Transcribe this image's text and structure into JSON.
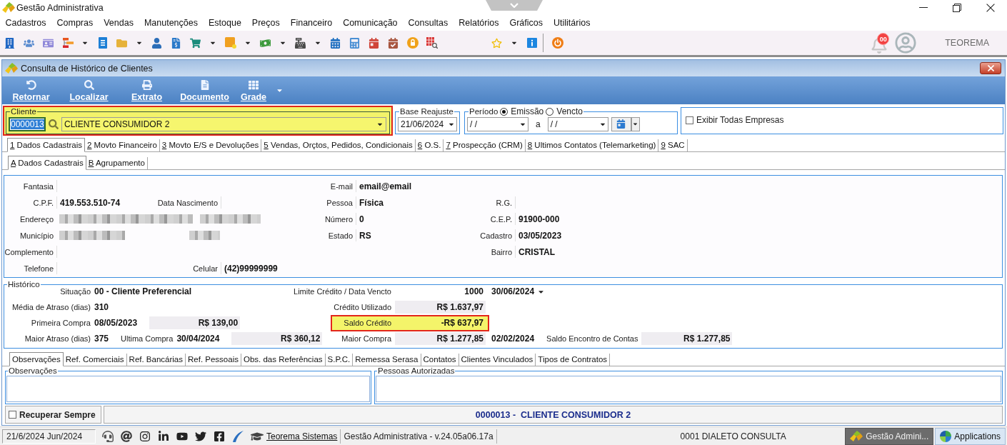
{
  "window": {
    "title": "Gestão Administrativa"
  },
  "menu": [
    "Cadastros",
    "Compras",
    "Vendas",
    "Manutenções",
    "Estoque",
    "Preços",
    "Financeiro",
    "Comunicação",
    "Consultas",
    "Relatórios",
    "Gráficos",
    "Utilitários"
  ],
  "toolbar": {
    "groups": [
      [
        {
          "menu": false
        },
        {
          "menu": false
        },
        {
          "menu": false
        },
        {
          "menu": true
        },
        {
          "menu": false
        },
        {
          "menu": true
        },
        {
          "menu": false
        },
        {
          "menu": false
        },
        {
          "menu": true
        },
        {
          "menu": true
        },
        {
          "menu": true
        },
        {
          "menu": true
        },
        {
          "menu": false
        },
        {
          "menu": false
        },
        {
          "menu": false
        },
        {
          "menu": false
        },
        {
          "menu": false
        },
        {
          "menu": false
        }
      ],
      [
        {
          "menu": true
        },
        {
          "menu": false
        }
      ],
      [
        {
          "menu": false
        }
      ]
    ],
    "notification_badge": "00",
    "user": "TEOREMA"
  },
  "form": {
    "title": "Consulta de Histórico de Clientes",
    "actions": [
      {
        "label": "Retornar",
        "menu": false
      },
      {
        "label": "Localizar",
        "menu": false
      },
      {
        "label": "Extrato",
        "menu": false
      },
      {
        "label": "Documento",
        "menu": false
      },
      {
        "label": "Grade",
        "menu": true
      }
    ],
    "client": {
      "legend": "Cliente",
      "code": "0000013",
      "code_selected": true,
      "name": "CLIENTE CONSUMIDOR 2",
      "highlighted": true
    },
    "base_reajuste": {
      "legend": "Base Reajuste",
      "value": "21/06/2024"
    },
    "periodo": {
      "legend": "Período",
      "options": [
        {
          "label": "Emissão",
          "selected": true
        },
        {
          "label": "Vencto",
          "selected": false
        }
      ],
      "from": "/ /",
      "separator": "a",
      "to": "/ /"
    },
    "all_companies": {
      "label": "Exibir Todas Empresas",
      "checked": false
    },
    "main_tabs": [
      {
        "key": "1",
        "label": "Dados Cadastrais",
        "selected": true
      },
      {
        "key": "2",
        "label": "Movto Financeiro",
        "selected": false
      },
      {
        "key": "3",
        "label": "Movto E/S e Devoluções",
        "selected": false
      },
      {
        "key": "5",
        "label": "Vendas, Orçtos, Pedidos, Condicionais",
        "selected": false
      },
      {
        "key": "6",
        "label": "O.S.",
        "selected": false
      },
      {
        "key": "7",
        "label": "Prospecção (CRM)",
        "selected": false
      },
      {
        "key": "8",
        "label": "Ultimos Contatos (Telemarketing)",
        "selected": false
      },
      {
        "key": "9",
        "label": "SAC",
        "selected": false
      }
    ],
    "sub_tabs": [
      {
        "key": "A",
        "label": "Dados Cadastrais",
        "selected": true
      },
      {
        "key": "B",
        "label": "Agrupamento",
        "selected": false
      }
    ],
    "details": [
      {
        "col_1": {
          "label": "Fantasia"
        },
        "col_3": {
          "label": "E-mail",
          "value": "email@email"
        }
      },
      {
        "col_1": {
          "label": "C.P.F.",
          "value": "419.553.510-74"
        },
        "col_2": {
          "label": "Data Nascimento"
        },
        "col_3": {
          "label": "Pessoa",
          "value": "Física"
        },
        "col_4": {
          "label": "R.G."
        }
      },
      {
        "col_1": {
          "label": "Endereço",
          "redacted": true
        },
        "col_3": {
          "label": "Número",
          "value": "0"
        },
        "col_4": {
          "label": "C.E.P.",
          "value": "91900-000"
        }
      },
      {
        "col_1": {
          "label": "Município",
          "redacted": true
        },
        "col_3": {
          "label": "Estado",
          "value": "RS"
        },
        "col_4": {
          "label": "Cadastro",
          "value": "03/05/2023"
        }
      },
      {
        "col_1": {
          "label": "Complemento"
        },
        "col_4": {
          "label": "Bairro",
          "value": "CRISTAL"
        }
      },
      {
        "col_1": {
          "label": "Telefone"
        },
        "col_2": {
          "label": "Celular",
          "value": "(42)99999999"
        }
      }
    ],
    "history": {
      "legend": "Histórico",
      "rows": [
        {
          "left": [
            {
              "kind": "label",
              "text": "Situação"
            },
            {
              "kind": "value",
              "text": "00 - Cliente Preferencial"
            }
          ],
          "right": {
            "highlighted": false,
            "items": [
              {
                "kind": "label",
                "text": "Limite Crédito / Data Vencto"
              },
              {
                "kind": "figure",
                "text": "1000"
              },
              {
                "kind": "date_select",
                "text": "30/06/2024"
              }
            ]
          }
        },
        {
          "left": [
            {
              "kind": "label",
              "text": "Média de Atraso (dias)"
            },
            {
              "kind": "value",
              "text": "310"
            }
          ],
          "right": {
            "highlighted": false,
            "items": [
              {
                "kind": "label",
                "text": "Crédito Utilizado"
              },
              {
                "kind": "amount",
                "text": "R$ 1.637,97"
              }
            ]
          }
        },
        {
          "left": [
            {
              "kind": "label",
              "text": "Primeira Compra"
            },
            {
              "kind": "value",
              "text": "08/05/2023"
            },
            {
              "kind": "amount",
              "text": "R$ 139,00"
            }
          ],
          "right": {
            "highlighted": true,
            "items": [
              {
                "kind": "label",
                "text": "Saldo Crédito"
              },
              {
                "kind": "amount",
                "text": "-R$ 637,97"
              }
            ]
          }
        },
        {
          "left": [
            {
              "kind": "label",
              "text": "Maior Atraso (dias)"
            },
            {
              "kind": "value",
              "text": "375"
            },
            {
              "kind": "label",
              "text": "Ultima Compra"
            },
            {
              "kind": "value",
              "text": "30/04/2024"
            },
            {
              "kind": "amount",
              "text": "R$ 360,12"
            }
          ],
          "right": {
            "highlighted": false,
            "items": [
              {
                "kind": "label",
                "text": "Maior Compra"
              },
              {
                "kind": "amount",
                "text": "R$ 1.277,85"
              },
              {
                "kind": "value",
                "text": "02/02/2024"
              },
              {
                "kind": "label",
                "text": "Saldo Encontro de Contas"
              },
              {
                "kind": "amount",
                "text": "R$ 1.277,85"
              }
            ]
          }
        }
      ]
    },
    "detail_tabs": [
      {
        "label": "Observações",
        "selected": true
      },
      {
        "label": "Ref. Comerciais",
        "selected": false
      },
      {
        "label": "Ref. Bancárias",
        "selected": false
      },
      {
        "label": "Ref. Pessoais",
        "selected": false
      },
      {
        "label": "Obs. das Referências",
        "selected": false
      },
      {
        "label": "S.P.C.",
        "selected": false
      },
      {
        "label": "Remessa Serasa",
        "selected": false
      },
      {
        "label": "Contatos",
        "selected": false
      },
      {
        "label": "Clientes Vinculados",
        "selected": false
      },
      {
        "label": "Tipos de Contratos",
        "selected": false
      }
    ],
    "notes": [
      {
        "legend": "Observações"
      },
      {
        "legend": "Pessoas Autorizadas"
      }
    ],
    "recover_always": {
      "label": "Recuperar Sempre",
      "checked": false
    },
    "footer_client": "0000013 -  CLIENTE CONSUMIDOR 2"
  },
  "status_bar": {
    "date": "21/6/2024 Jun/2024",
    "link": "Teorema Sistemas",
    "version": "Gestão Administrativa - v.24.05a06.17a",
    "company": "0001 DIALETO CONSULTA",
    "tasks": [
      {
        "label": "Gestão Admini...",
        "active": true
      },
      {
        "label": "Applications",
        "active": false
      }
    ]
  }
}
